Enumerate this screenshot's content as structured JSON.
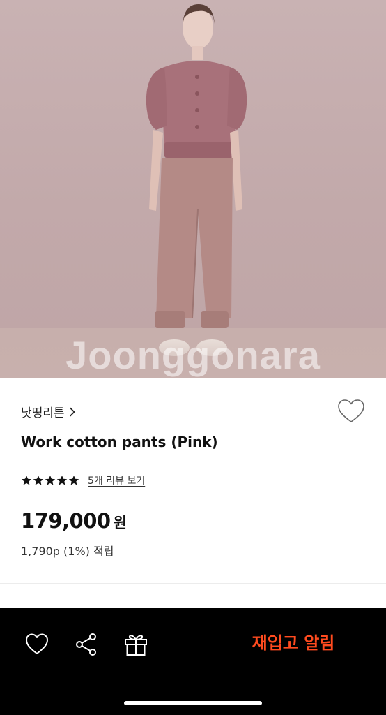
{
  "product": {
    "watermark": "Joonggonara",
    "brand": "낫띵리튼",
    "title": "Work cotton pants (Pink)",
    "rating": 5,
    "review_link": "5개 리뷰 보기",
    "price": "179,000",
    "currency": "원",
    "points": "1,790p (1%) 적립"
  },
  "icons": {
    "brand_chevron": "chevron-right-icon",
    "wish": "heart-outline-icon",
    "star": "star-icon",
    "bar_heart": "heart-outline-icon",
    "bar_share": "share-icon",
    "bar_gift": "gift-icon"
  },
  "bottom_bar": {
    "restock_label": "재입고 알림",
    "accent_color": "#ff4b1f"
  }
}
